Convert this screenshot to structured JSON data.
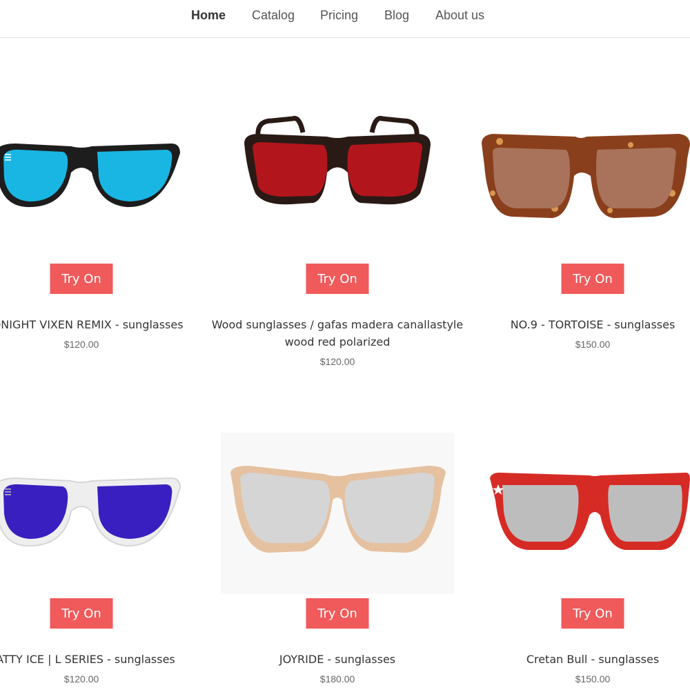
{
  "nav": {
    "items": [
      {
        "label": "Home",
        "active": true
      },
      {
        "label": "Catalog",
        "active": false
      },
      {
        "label": "Pricing",
        "active": false
      },
      {
        "label": "Blog",
        "active": false
      },
      {
        "label": "About us",
        "active": false
      }
    ]
  },
  "colors": {
    "button_bg": "#f05a5b",
    "button_text": "#ffffff",
    "text": "#333333",
    "price_text": "#666666"
  },
  "products": [
    {
      "title": "MIDNIGHT VIXEN REMIX - sunglasses",
      "price": "$120.00",
      "button": "Try On",
      "frame_color": "#1d1d1d",
      "lens_color": "#19b6e3"
    },
    {
      "title": "Wood sunglasses / gafas madera canallastyle wood red polarized",
      "price": "$120.00",
      "button": "Try On",
      "frame_color": "#2a1a16",
      "lens_color": "#b3151c"
    },
    {
      "title": "NO.9 - TORTOISE - sunglasses",
      "price": "$150.00",
      "button": "Try On",
      "frame_color": "#8a3f1c",
      "lens_color": "#a8735a"
    },
    {
      "title": "NATTY ICE | L SERIES - sunglasses",
      "price": "$120.00",
      "button": "Try On",
      "frame_color": "#eeeeee",
      "lens_color": "#3a1fc0"
    },
    {
      "title": "JOYRIDE - sunglasses",
      "price": "$180.00",
      "button": "Try On",
      "frame_color": "#e5c1a0",
      "lens_color": "#d5d5d5"
    },
    {
      "title": "Cretan Bull - sunglasses",
      "price": "$150.00",
      "button": "Try On",
      "frame_color": "#d62b25",
      "lens_color": "#bdbdbd"
    }
  ]
}
